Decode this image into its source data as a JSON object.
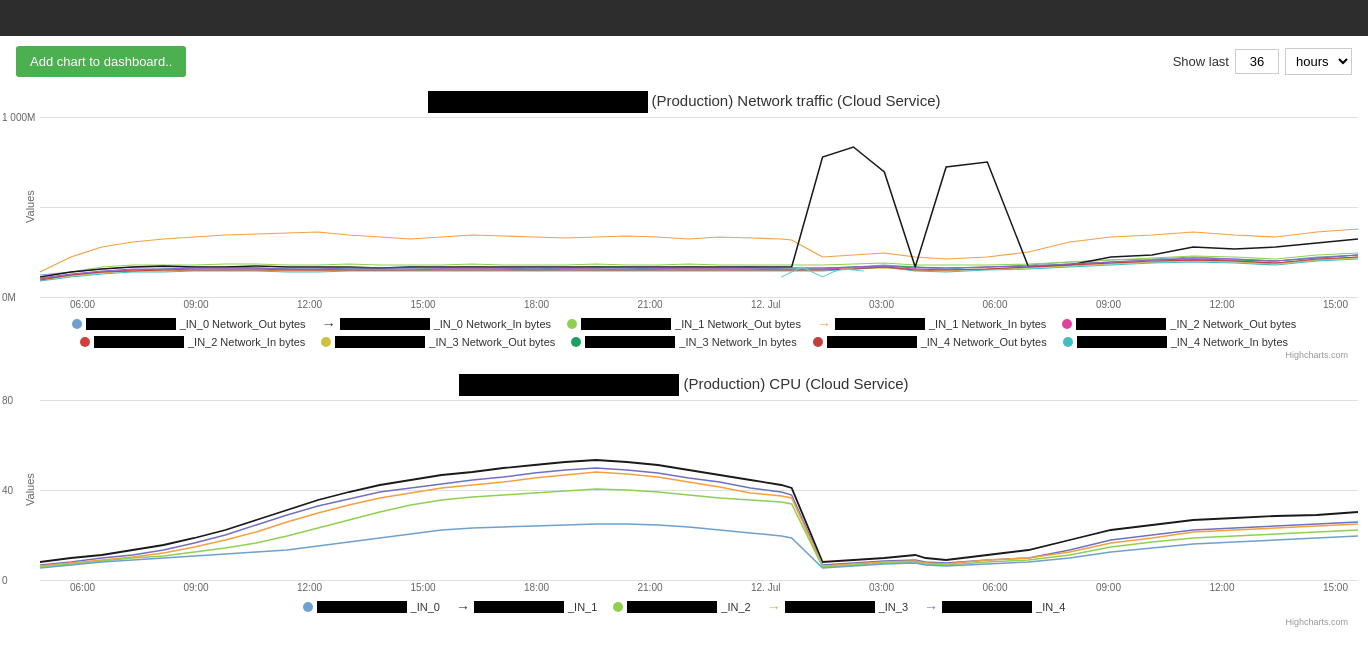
{
  "topbar": {},
  "toolbar": {
    "add_chart_label": "Add chart to dashboard..",
    "show_last_label": "Show last",
    "show_last_value": "36",
    "hours_option": "hours"
  },
  "chart1": {
    "title_suffix": "(Production) Network traffic (Cloud Service)",
    "y_label": "Values",
    "y_max": "1 000M",
    "y_min": "0M",
    "x_labels": [
      "06:00",
      "09:00",
      "12:00",
      "15:00",
      "18:00",
      "21:00",
      "12. Jul",
      "03:00",
      "06:00",
      "09:00",
      "12:00",
      "15:00"
    ],
    "legend": [
      {
        "color": "#6fa0d0",
        "arrow": "→",
        "label1_redacted": true,
        "label1": "_IN_0 Network_Out bytes"
      },
      {
        "color": "#333",
        "arrow": "→",
        "label1_redacted": true,
        "label1": "_IN_0 Network_In bytes"
      },
      {
        "color": "#90d050",
        "arrow": "→",
        "label1_redacted": true,
        "label1": "_IN_1 Network_Out bytes"
      },
      {
        "color": "#f5a040",
        "arrow": "→",
        "label1_redacted": true,
        "label1": "_IN_1 Network_In bytes"
      },
      {
        "color": "#e040a0",
        "arrow": "→",
        "label1_redacted": true,
        "label1": "_IN_2 Network_Out bytes"
      },
      {
        "color": "#d04040",
        "arrow": "→",
        "label1_redacted": true,
        "label1": "_IN_2 Network_In bytes"
      },
      {
        "color": "#d0c040",
        "arrow": "→",
        "label1_redacted": true,
        "label1": "_IN_3 Network_Out bytes"
      },
      {
        "color": "#20a060",
        "arrow": "→",
        "label1_redacted": true,
        "label1": "_IN_3 Network_In bytes"
      },
      {
        "color": "#c04040",
        "arrow": "→",
        "label1_redacted": true,
        "label1": "_IN_4 Network_Out bytes"
      },
      {
        "color": "#40c0c0",
        "arrow": "→",
        "label1_redacted": true,
        "label1": "_IN_4 Network_In bytes"
      }
    ]
  },
  "chart2": {
    "title_suffix": "(Production) CPU (Cloud Service)",
    "y_label": "Values",
    "y_max": "80",
    "y_mid": "40",
    "y_min": "0",
    "x_labels": [
      "06:00",
      "09:00",
      "12:00",
      "15:00",
      "18:00",
      "21:00",
      "12. Jul",
      "03:00",
      "06:00",
      "09:00",
      "12:00",
      "15:00"
    ],
    "legend": [
      {
        "color": "#6fa0d0",
        "arrow": "→",
        "label_redacted": true,
        "label": "_IN_0"
      },
      {
        "color": "#333",
        "arrow": "→",
        "label_redacted": true,
        "label": "_IN_1"
      },
      {
        "color": "#90d050",
        "arrow": "→",
        "label_redacted": true,
        "label": "_IN_2"
      },
      {
        "color": "#f5a040",
        "arrow": "→",
        "label_redacted": true,
        "label": "_IN_3"
      },
      {
        "color": "#7070c0",
        "arrow": "→",
        "label_redacted": true,
        "label": "_IN_4"
      }
    ]
  },
  "highcharts_credit": "Highcharts.com"
}
